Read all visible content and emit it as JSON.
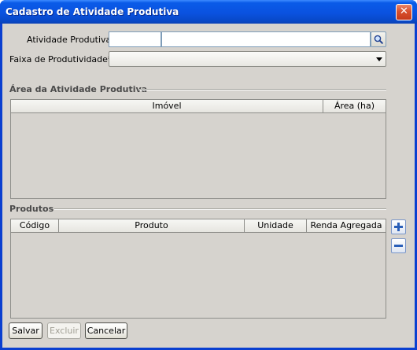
{
  "window": {
    "title": "Cadastro de Atividade Produtiva",
    "close_label": "✕"
  },
  "form": {
    "atividade_label": "Atividade Produtiva:",
    "atividade_code_value": "",
    "atividade_desc_value": "",
    "faixa_label": "Faixa de Produtividade*:",
    "faixa_value": ""
  },
  "area_section": {
    "title": "Área da Atividade Produtiva",
    "columns": [
      "Imóvel",
      "Área (ha)"
    ]
  },
  "produtos_section": {
    "title": "Produtos",
    "columns": [
      "Código",
      "Produto",
      "Unidade",
      "Renda Agregada"
    ]
  },
  "actions": {
    "save_label": "Salvar",
    "delete_label": "Excluir",
    "cancel_label": "Cancelar"
  },
  "icons": {
    "search": "search-icon",
    "add": "plus-icon",
    "remove": "minus-icon"
  },
  "colors": {
    "titlebar": "#0a52e0",
    "close": "#d8502e",
    "panel": "#d6d3ce"
  }
}
